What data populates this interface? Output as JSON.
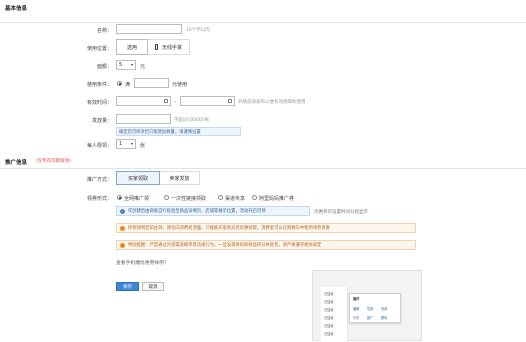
{
  "basic": {
    "title": "基本信息",
    "name_label": "名称：",
    "name_hint": "10个字以内",
    "position_label": "使用位置：",
    "position_opt1": "选用",
    "position_opt2": "无线手掌",
    "amount_label": "面额：",
    "amount_value": "5",
    "amount_unit": "元",
    "condition_label": "使用条件：",
    "condition_none": "满",
    "condition_suffix": "元使用",
    "validity_label": "有效时间：",
    "validity_sep": "-",
    "validity_hint": "开始前请发布以便有效保障利使用",
    "quantity_label": "发放量：",
    "quantity_hint": "不超过100000张",
    "quantity_note": "确定后可修改但只能增加数量，请谨慎设置",
    "limit_label": "每人限领：",
    "limit_value": "1",
    "limit_unit": "张"
  },
  "promo": {
    "title": "推广信息",
    "title_note": "（仅专有可转发领）",
    "method_label": "推广方式：",
    "tab_active": "买家领取",
    "tab_inactive": "卖家发放",
    "type_label": "领券形式：",
    "type_opt1": "全网推广领",
    "type_opt2": "一次性链接领取",
    "type_opt3": "渠道专享",
    "type_opt4": "阿里妈妈推广券",
    "notice_blue": "仅创建后由商家自行投放至商品详情页、店铺等展示位置，活动开启可领",
    "notice_blue_right": "优惠券可设置时间分段显示",
    "notice_orange1": "所领领到后前往领，请勿向消费者泄露，只能被买家购买后优惠领取，消费者可以在购物车中使用领券查看",
    "notice_orange2": "特别提醒：严禁通过外部渠道刷单等违规行为，一旦发现将扣除商品积分并处罚，请严格遵守相关规定",
    "link": "查看手机端优惠券样例？",
    "save_label": "保存",
    "cancel_label": "取消"
  },
  "preview": {
    "header": "操作",
    "items": [
      "编辑",
      "复制",
      "查看",
      "分享",
      "推广",
      "删除"
    ],
    "rows": [
      "已结束",
      "已结束",
      "已结束",
      "已结束",
      "已结束",
      "已结束"
    ]
  }
}
